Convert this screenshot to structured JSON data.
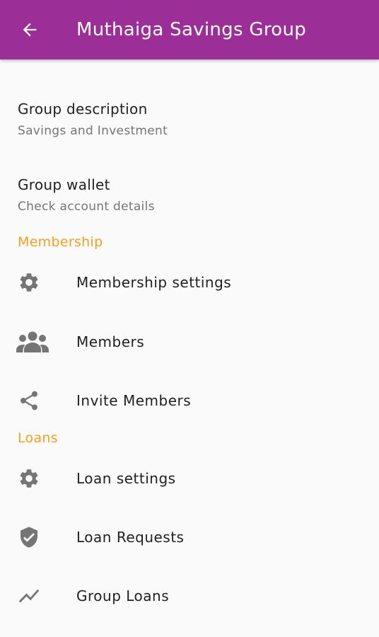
{
  "appbar": {
    "title": "Muthaiga Savings Group",
    "back_icon": "arrow-back-icon",
    "color": "#9b2e97"
  },
  "group_description": {
    "title": "Group description",
    "subtitle": "Savings and Investment"
  },
  "group_wallet": {
    "title": "Group wallet",
    "subtitle": "Check account details"
  },
  "membership": {
    "header": "Membership",
    "items": [
      {
        "label": "Membership settings",
        "icon": "gear-icon"
      },
      {
        "label": "Members",
        "icon": "people-icon"
      },
      {
        "label": "Invite Members",
        "icon": "share-icon"
      }
    ]
  },
  "loans": {
    "header": "Loans",
    "items": [
      {
        "label": "Loan settings",
        "icon": "gear-icon"
      },
      {
        "label": "Loan Requests",
        "icon": "verified-shield-icon"
      },
      {
        "label": "Group Loans",
        "icon": "trending-icon"
      }
    ]
  },
  "colors": {
    "section_header": "#f5a01a",
    "icon": "#757575"
  }
}
